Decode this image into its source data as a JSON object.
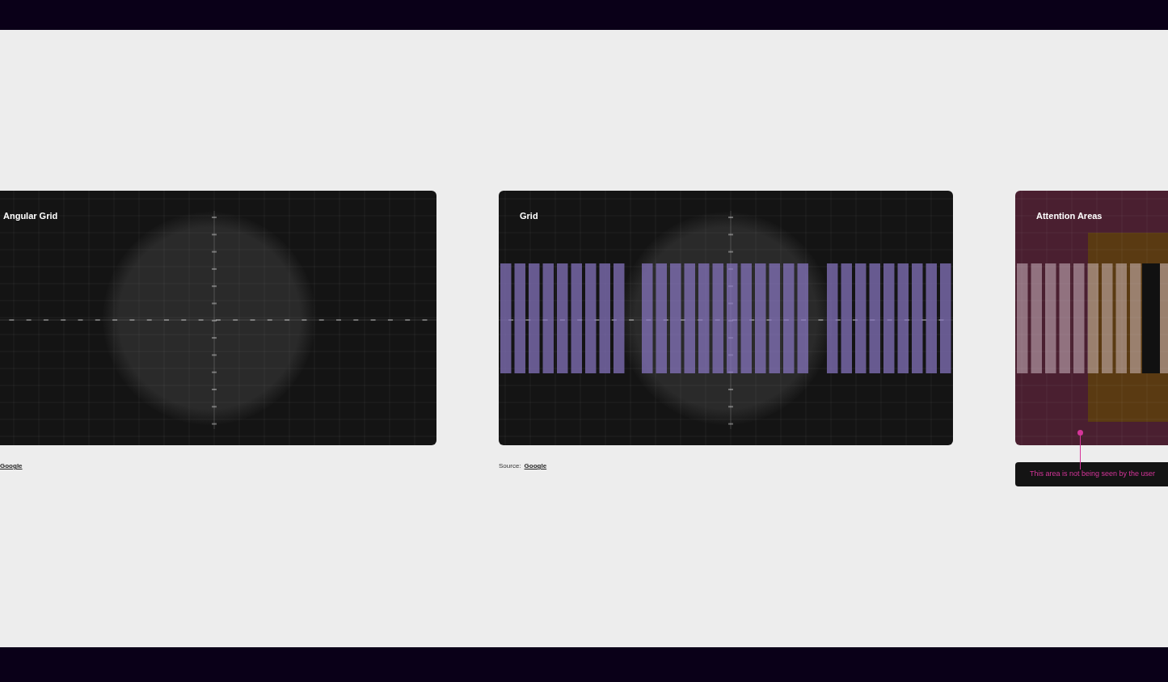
{
  "cards": [
    {
      "kind": "angular",
      "title": "Angular Grid",
      "source_link": "Google"
    },
    {
      "kind": "grid",
      "title": "Grid",
      "source_label": "Source:",
      "source_link": "Google"
    },
    {
      "kind": "attention",
      "title": "Attention Areas",
      "note": "This area is not being seen by the user"
    }
  ]
}
